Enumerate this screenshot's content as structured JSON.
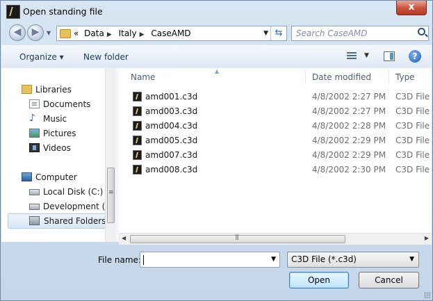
{
  "window": {
    "title": "Open standing file",
    "close_label": "x"
  },
  "address": {
    "breadcrumbs": [
      "«",
      "Data",
      "Italy",
      "CaseAMD"
    ],
    "search_placeholder": "Search CaseAMD"
  },
  "commandbar": {
    "organize_label": "Organize ▾",
    "new_folder_label": "New folder",
    "help_label": "?"
  },
  "navpane": {
    "libraries": "Libraries",
    "documents": "Documents",
    "music": "Music",
    "pictures": "Pictures",
    "videos": "Videos",
    "computer": "Computer",
    "local_disk": "Local Disk (C:)",
    "development": "Development (E:)",
    "shared_folders": "Shared Folders (\\"
  },
  "filelist": {
    "columns": {
      "name": "Name",
      "date": "Date modified",
      "type": "Type"
    },
    "rows": [
      {
        "name": "amd001.c3d",
        "date": "4/8/2002 2:27 PM",
        "type": "C3D File"
      },
      {
        "name": "amd003.c3d",
        "date": "4/8/2002 2:27 PM",
        "type": "C3D File"
      },
      {
        "name": "amd004.c3d",
        "date": "4/8/2002 2:28 PM",
        "type": "C3D File"
      },
      {
        "name": "amd005.c3d",
        "date": "4/8/2002 2:29 PM",
        "type": "C3D File"
      },
      {
        "name": "amd007.c3d",
        "date": "4/8/2002 2:29 PM",
        "type": "C3D File"
      },
      {
        "name": "amd008.c3d",
        "date": "4/8/2002 2:30 PM",
        "type": "C3D File"
      }
    ]
  },
  "footer": {
    "file_name_label": "File name:",
    "file_name_value": "",
    "file_type": "C3D File (*.c3d)",
    "open_label": "Open",
    "cancel_label": "Cancel"
  },
  "colors": {
    "accent": "#3c7fb1",
    "frame": "#c4d6e9",
    "selection": "#d9e7f7"
  }
}
